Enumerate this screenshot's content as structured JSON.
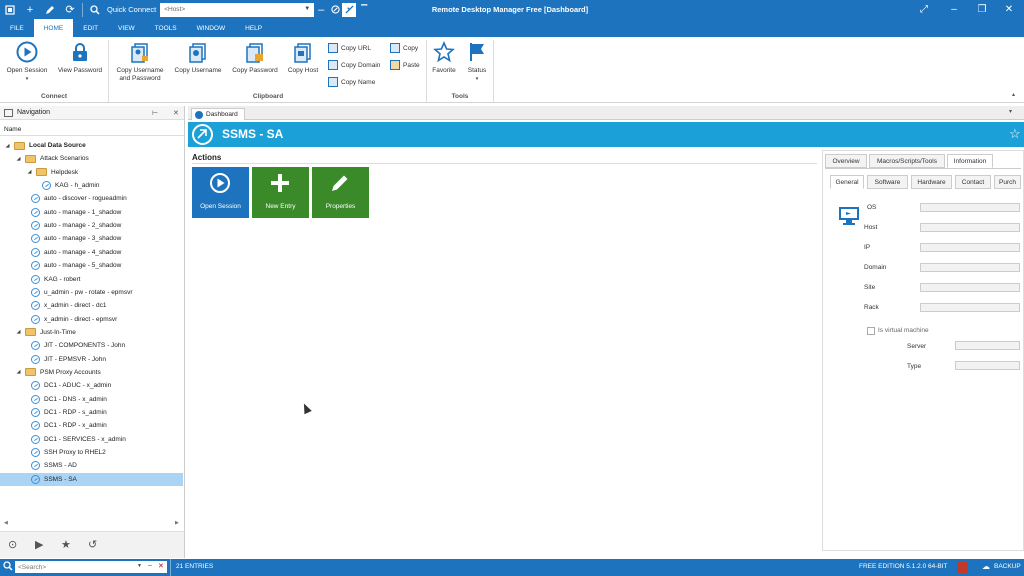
{
  "titlebar": {
    "quick_connect_label": "Quick Connect",
    "host_placeholder": "<Host>",
    "window_title": "Remote Desktop Manager Free [Dashboard]"
  },
  "menu": [
    "FILE",
    "HOME",
    "EDIT",
    "VIEW",
    "TOOLS",
    "WINDOW",
    "HELP"
  ],
  "menu_active": "HOME",
  "ribbon": {
    "open_session": "Open Session",
    "view_password": "View Password",
    "copy_username_password_line1": "Copy Username",
    "copy_username_password_line2": "and Password",
    "copy_username": "Copy Username",
    "copy_password": "Copy Password",
    "copy_host": "Copy Host",
    "copy_url": "Copy URL",
    "copy_domain": "Copy Domain",
    "copy_name": "Copy Name",
    "copy": "Copy",
    "paste": "Paste",
    "favorite": "Favorite",
    "status": "Status",
    "group_connect": "Connect",
    "group_clipboard": "Clipboard",
    "group_tools": "Tools"
  },
  "navigation": {
    "title": "Navigation",
    "column": "Name",
    "tree": [
      {
        "label": "Local Data Source",
        "kind": "root"
      },
      {
        "label": "Attack Scenarios",
        "kind": "folder"
      },
      {
        "label": "Helpdesk",
        "kind": "folder"
      },
      {
        "label": "KAG - h_admin",
        "kind": "entry"
      },
      {
        "label": "auto - discover - rogueadmin",
        "kind": "entry"
      },
      {
        "label": "auto - manage - 1_shadow",
        "kind": "entry"
      },
      {
        "label": "auto - manage - 2_shadow",
        "kind": "entry"
      },
      {
        "label": "auto - manage - 3_shadow",
        "kind": "entry"
      },
      {
        "label": "auto - manage - 4_shadow",
        "kind": "entry"
      },
      {
        "label": "auto - manage - 5_shadow",
        "kind": "entry"
      },
      {
        "label": "KAG - robert",
        "kind": "entry"
      },
      {
        "label": "u_admin - pw - rotate - epmsvr",
        "kind": "entry"
      },
      {
        "label": "x_admin - direct - dc1",
        "kind": "entry"
      },
      {
        "label": "x_admin - direct - epmsvr",
        "kind": "entry"
      },
      {
        "label": "Just-In-Time",
        "kind": "folder"
      },
      {
        "label": "JIT - COMPONENTS - John",
        "kind": "entry"
      },
      {
        "label": "JIT - EPMSVR - John",
        "kind": "entry"
      },
      {
        "label": "PSM Proxy Accounts",
        "kind": "folder"
      },
      {
        "label": "DC1 - ADUC - x_admin",
        "kind": "entry"
      },
      {
        "label": "DC1 - DNS - x_admin",
        "kind": "entry"
      },
      {
        "label": "DC1 - RDP - s_admin",
        "kind": "entry"
      },
      {
        "label": "DC1 - RDP - x_admin",
        "kind": "entry"
      },
      {
        "label": "DC1 - SERVICES - x_admin",
        "kind": "entry"
      },
      {
        "label": "SSH Proxy to RHEL2",
        "kind": "entry"
      },
      {
        "label": "SSMS - AD",
        "kind": "entry"
      },
      {
        "label": "SSMS - SA",
        "kind": "entry",
        "selected": true
      }
    ]
  },
  "document": {
    "tab_label": "Dashboard",
    "entry_title": "SSMS - SA",
    "actions_label": "Actions",
    "tiles": [
      {
        "label": "Open Session",
        "color": "#1e73be",
        "icon": "play-icon"
      },
      {
        "label": "New Entry",
        "color": "#3a8a2a",
        "icon": "plus-icon"
      },
      {
        "label": "Properties",
        "color": "#3a8a2a",
        "icon": "pencil-icon"
      }
    ]
  },
  "details": {
    "tabs": [
      "Overview",
      "Macros/Scripts/Tools",
      "Information"
    ],
    "active_tab": "Information",
    "subtabs": [
      "General",
      "Software",
      "Hardware",
      "Contact",
      "Purch"
    ],
    "active_subtab": "General",
    "fields": [
      "OS",
      "Host",
      "IP",
      "Domain",
      "Site",
      "Rack"
    ],
    "virtual_machine_label": "Is virtual machine",
    "server_label": "Server",
    "type_label": "Type"
  },
  "statusbar": {
    "search_placeholder": "<Search>",
    "entries": "21 ENTRIES",
    "edition": "FREE EDITION 5.1.2.0 64-BIT",
    "backup": "BACKUP"
  },
  "colors": {
    "brand": "#1e73be",
    "header": "#1ba0d8",
    "tile_green": "#3a8a2a",
    "selection": "#aad4f5"
  }
}
